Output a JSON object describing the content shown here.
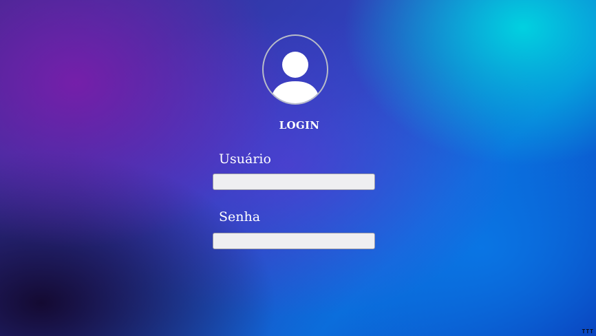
{
  "login": {
    "avatar_icon": "user-icon",
    "title": "LOGIN",
    "username_label": "Usuário",
    "username_value": "",
    "password_label": "Senha",
    "password_value": ""
  },
  "footer": {
    "corner_text": "TTT"
  },
  "colors": {
    "text": "#ffffff",
    "input_background": "#efeff1",
    "input_border": "#9a9aa6",
    "avatar_border": "#b8bcc8"
  }
}
